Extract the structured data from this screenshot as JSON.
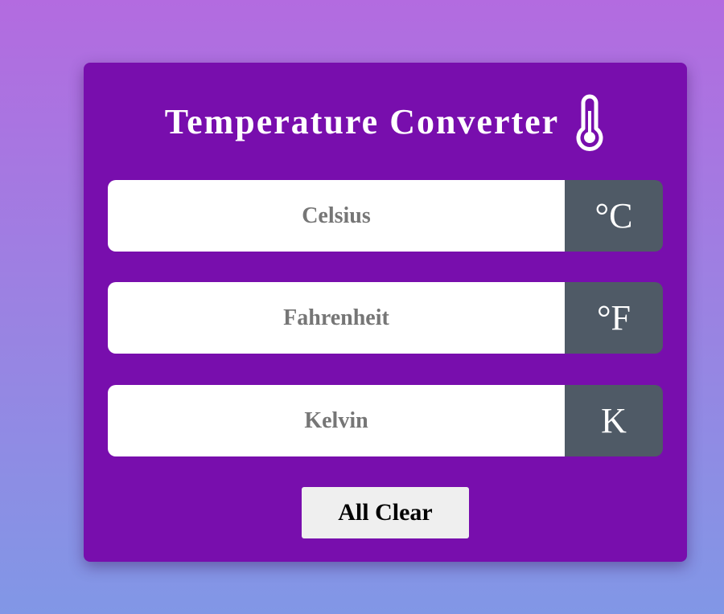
{
  "app": {
    "title": "Temperature Converter",
    "title_icon": "thermometer-icon"
  },
  "fields": {
    "celsius": {
      "placeholder": "Celsius",
      "value": "",
      "unit": "°C"
    },
    "fahrenheit": {
      "placeholder": "Fahrenheit",
      "value": "",
      "unit": "°F"
    },
    "kelvin": {
      "placeholder": "Kelvin",
      "value": "",
      "unit": "K"
    }
  },
  "actions": {
    "clear_label": "All Clear"
  },
  "colors": {
    "background_top": "#b36be0",
    "background_bottom": "#8197e6",
    "card": "#780ead",
    "unit_box": "#4f5a66",
    "button": "#efefef",
    "text_white": "#ffffff",
    "placeholder": "#767676"
  }
}
